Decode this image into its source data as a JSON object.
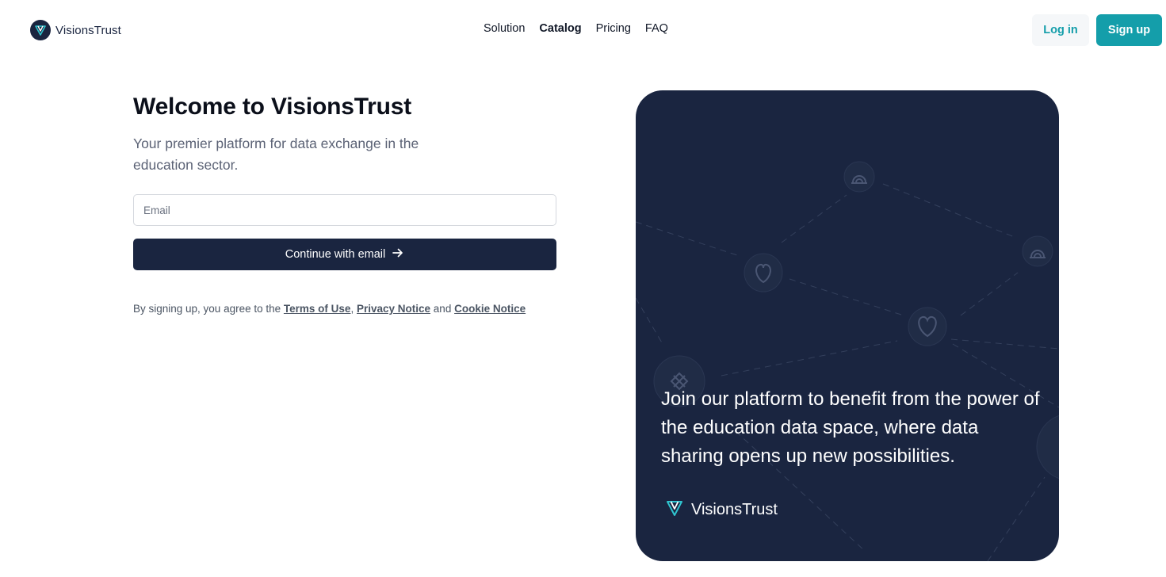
{
  "brand": {
    "name": "VisionsTrust"
  },
  "nav": [
    {
      "label": "Solution",
      "active": false
    },
    {
      "label": "Catalog",
      "active": true
    },
    {
      "label": "Pricing",
      "active": false
    },
    {
      "label": "FAQ",
      "active": false
    }
  ],
  "auth": {
    "login_label": "Log in",
    "signup_label": "Sign up"
  },
  "form": {
    "title": "Welcome to VisionsTrust",
    "subtitle": "Your premier platform for data exchange in the education sector.",
    "email_placeholder": "Email",
    "email_value": "",
    "continue_label": "Continue with email",
    "legal_prefix": "By signing up, you agree to the",
    "terms_label": "Terms of Use",
    "comma": ",",
    "privacy_label": "Privacy Notice",
    "and": "and",
    "cookie_label": "Cookie Notice"
  },
  "panel": {
    "message": "Join our platform to benefit from the power of the education data space, where data sharing opens up new possibilities.",
    "brand_name": "VisionsTrust"
  },
  "colors": {
    "primary": "#149eaa",
    "navy": "#1a2540",
    "muted_text": "#5b6275"
  },
  "icons": {
    "logo": "visionstrust-logo-icon",
    "continue": "arrow-right-icon"
  }
}
